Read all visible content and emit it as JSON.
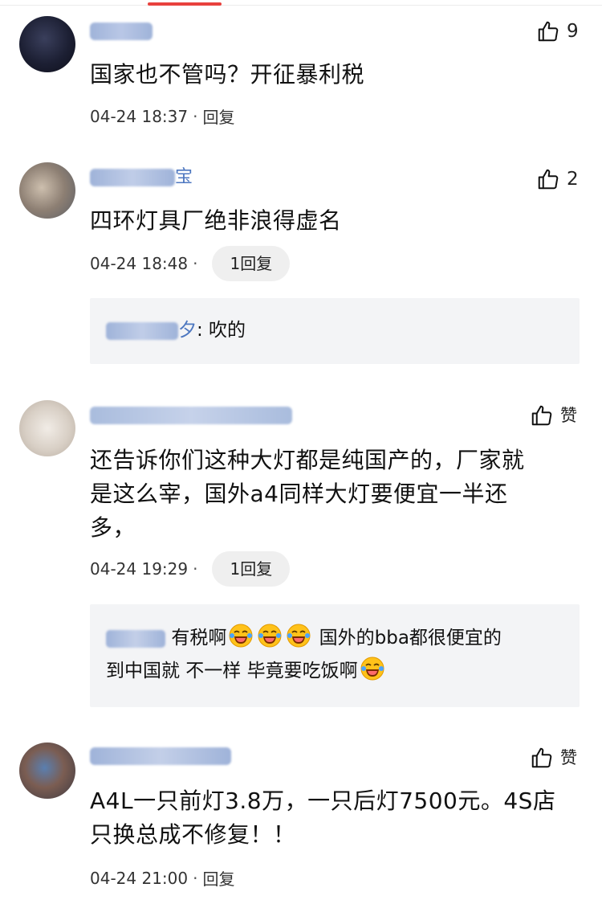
{
  "comments": [
    {
      "text": "国家也不管吗？开征暴利税",
      "time": "04-24 18:37",
      "reply_label": "回复",
      "likes": "9"
    },
    {
      "username_tail": "宝",
      "text": "四环灯具厂绝非浪得虚名",
      "time": "04-24 18:48",
      "reply_label": "1回复",
      "likes": "2",
      "sub_reply": {
        "name_tail": "夕",
        "text": ": 吹的"
      }
    },
    {
      "text_line1": "还告诉你们这种大灯都是纯国产的，厂家就",
      "text_line2": "是这么宰，国外a4同样大灯要便宜一半还",
      "text_line3": "多，",
      "time": "04-24 19:29",
      "reply_label": "1回复",
      "likes": "赞",
      "sub_reply": {
        "text_a": "有税啊",
        "text_b": "国外的bba都很便宜的",
        "text_c": "到中国就 不一样 毕竟要吃饭啊"
      }
    },
    {
      "text_line1": "A4L一只前灯3.8万，一只后灯7500元。4S店",
      "text_line2": "只换总成不修复！！",
      "time": "04-24 21:00",
      "reply_label": "回复",
      "likes": "赞"
    }
  ],
  "meta_separator": "·",
  "icons": {
    "like": "thumbs-up-icon",
    "emoji": "laughing-crying-emoji-icon"
  },
  "colors": {
    "accent": "#e8413d",
    "username": "#4d77c0",
    "subreply_bg": "#f3f4f6",
    "pill_bg": "#efefef"
  }
}
